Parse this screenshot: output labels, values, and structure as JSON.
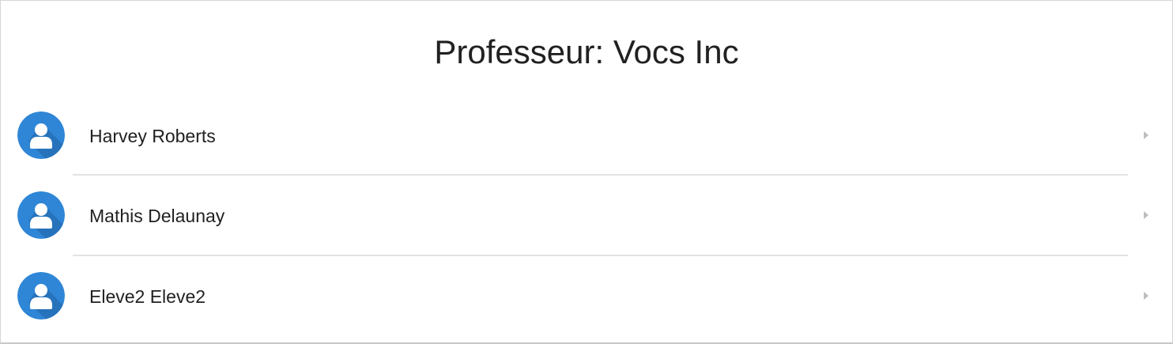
{
  "header": {
    "title": "Professeur: Vocs Inc"
  },
  "students": [
    {
      "name": "Harvey Roberts",
      "icon": "user-avatar-icon"
    },
    {
      "name": "Mathis Delaunay",
      "icon": "user-avatar-icon"
    },
    {
      "name": "Eleve2 Eleve2",
      "icon": "user-avatar-icon"
    }
  ],
  "colors": {
    "avatar_bg": "#2f86d6",
    "avatar_shadow": "#1f64a8",
    "avatar_person": "#ffffff",
    "chevron": "#bdbdbd",
    "divider": "#e3e3e3",
    "text": "#212121"
  }
}
